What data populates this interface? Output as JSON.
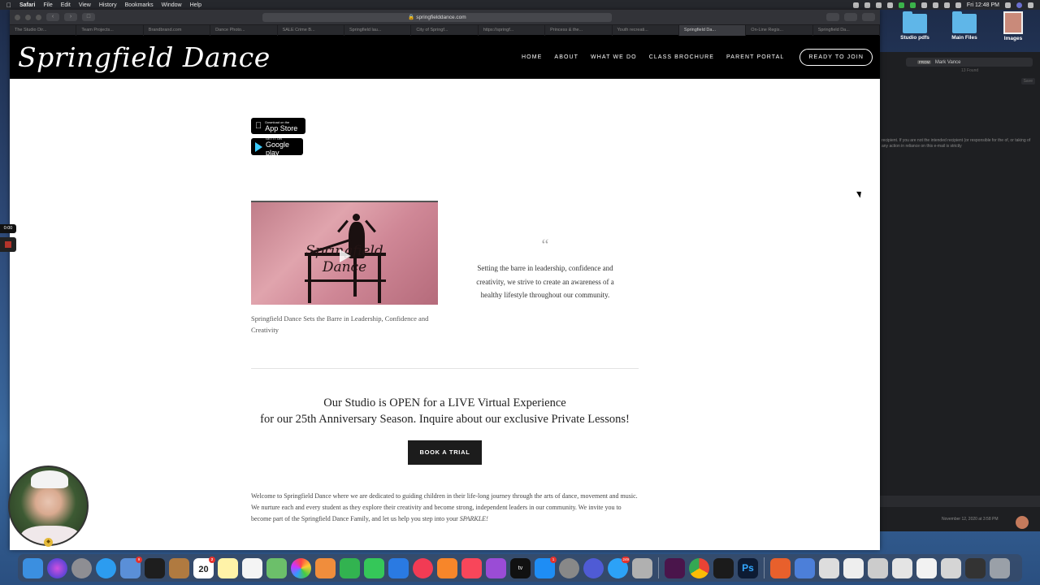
{
  "menubar": {
    "apple": "",
    "items": [
      "Safari",
      "File",
      "Edit",
      "View",
      "History",
      "Bookmarks",
      "Window",
      "Help"
    ],
    "clock": "Fri 12:48 PM"
  },
  "browser": {
    "url": "springfielddance.com",
    "tabs": [
      "The Studio Dir...",
      "Team Projects...",
      "Brandbrand.com",
      "Dance Photo...",
      "SALE Crime B...",
      "Springfield lau...",
      "City of Springf...",
      "https://springf...",
      "Princess & the...",
      "Youth recreati...",
      "Springfield Da...",
      "On-Line Regis...",
      "Springfield Da..."
    ],
    "active_tab_index": 10
  },
  "site": {
    "logo": "Springfield Dance",
    "nav": [
      "HOME",
      "ABOUT",
      "WHAT WE DO",
      "CLASS BROCHURE",
      "PARENT PORTAL"
    ],
    "join_button": "READY TO JOIN",
    "app_store": {
      "small": "Download on the",
      "big": "App Store"
    },
    "google_play": {
      "small": "GET IT ON",
      "big": "Google play"
    },
    "video": {
      "overlay_line1": "Springfield",
      "overlay_line2": "Dance"
    },
    "video_caption": "Springfield Dance Sets the Barre in Leadership, Confidence and Creativity",
    "quote_mark": "“",
    "quote": "Setting the barre in leadership, confidence and creativity, we strive to create an awareness of a healthy lifestyle throughout our community.",
    "headline_line1": "Our Studio is OPEN for a LIVE Virtual Experience",
    "headline_line2": "for our 25th Anniversary Season. Inquire about our exclusive Private Lessons!",
    "trial_button": "BOOK A TRIAL",
    "welcome_text": "Welcome to Springfield Dance where we are dedicated to guiding children in their life-long journey through the arts of dance, movement and music. We nurture each and every student as they explore their creativity and become strong, independent leaders in our community. We invite you to become part of the Springfield Dance Family, and let us help you step into your",
    "welcome_em": "SPARKLE!"
  },
  "desktop": {
    "items": [
      "Studio pdfs",
      "Main Files",
      "Images"
    ]
  },
  "mail": {
    "search_chip": "FROM",
    "search_value": "Mark Vance",
    "found": "13 Found",
    "save": "Save",
    "body_snippet": "recipient. If you are not the intended recipient (or responsible for the of, or taking of any action in reliance on this e-mail is strictly",
    "date": "November 12, 2020 at 3:58 PM"
  },
  "recorder": {
    "time": "0:00"
  },
  "dock": {
    "calendar_day": "20",
    "calendar_month": "NOV",
    "tv_label": "tv",
    "ps_label": "Ps",
    "badges": {
      "mail": "9",
      "calendar": "2",
      "appstore": "1",
      "messages": "249"
    }
  },
  "colors": {
    "header_bg": "#000000",
    "button_bg": "#1c1c1c",
    "accent_play": "#3bccff"
  }
}
